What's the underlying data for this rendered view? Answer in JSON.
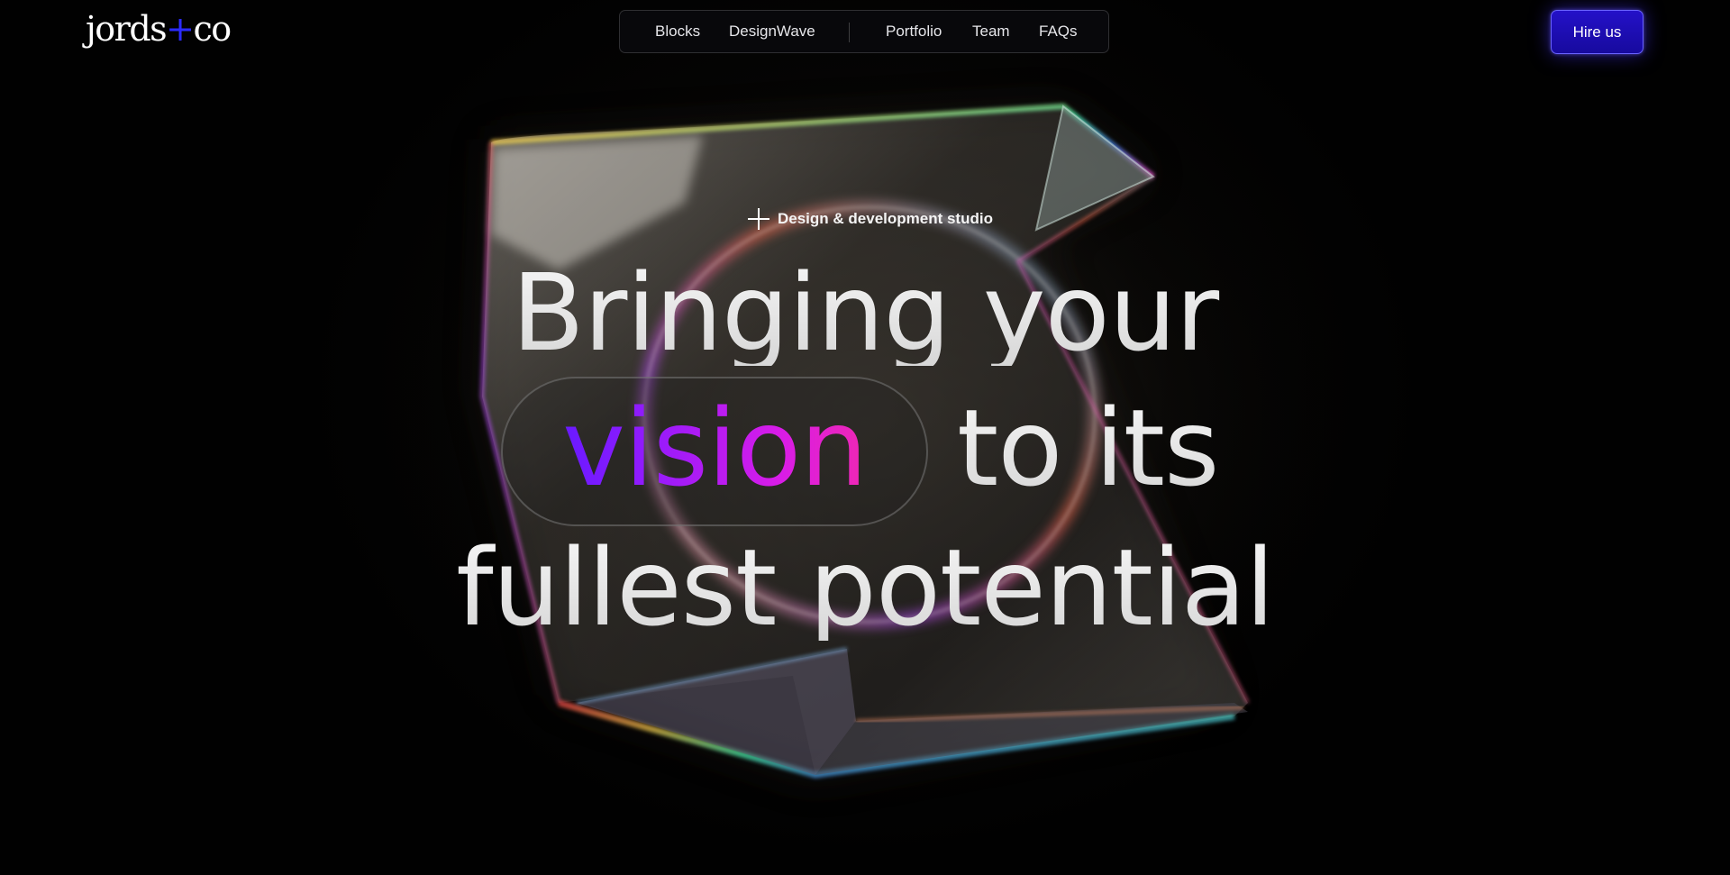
{
  "header": {
    "logo_text_left": "jords",
    "logo_plus": "+",
    "logo_text_right": "co",
    "logo_plus_color": "#2b2bff",
    "nav": [
      {
        "label": "Blocks"
      },
      {
        "label": "DesignWave"
      },
      {
        "label": "Portfolio"
      },
      {
        "label": "Team"
      },
      {
        "label": "FAQs"
      }
    ],
    "cta_label": "Hire us",
    "cta_color": "#1f10b8"
  },
  "hero": {
    "eyebrow_icon": "plus-cross-icon",
    "eyebrow": "Design & development studio",
    "line1": "Bringing your",
    "highlight_word": "vision",
    "line2_rest": "to its",
    "line3": "fullest potential",
    "highlight_gradient": [
      "#4a19ff",
      "#d81ce8",
      "#ff2f8f"
    ]
  }
}
